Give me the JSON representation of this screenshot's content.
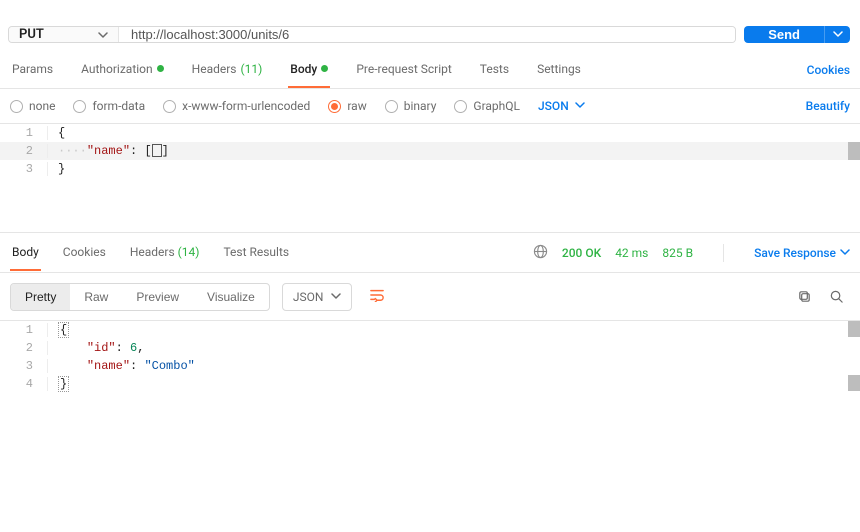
{
  "request": {
    "method": "PUT",
    "url": "http://localhost:3000/units/6",
    "send_label": "Send"
  },
  "request_tabs": {
    "params": "Params",
    "authorization": "Authorization",
    "headers_label": "Headers",
    "headers_count": "(11)",
    "body": "Body",
    "pre_request": "Pre-request Script",
    "tests": "Tests",
    "settings": "Settings",
    "cookies": "Cookies"
  },
  "body_types": {
    "none": "none",
    "form_data": "form-data",
    "urlencoded": "x-www-form-urlencoded",
    "raw": "raw",
    "binary": "binary",
    "graphql": "GraphQL",
    "lang": "JSON",
    "beautify": "Beautify"
  },
  "request_body_lines": {
    "l1": "{",
    "l2_indent": "····",
    "l2_key": "\"name\"",
    "l2_colon": ": ",
    "l2_val_open": "[",
    "l2_val_close": "]",
    "l3": "}"
  },
  "response_tabs": {
    "body": "Body",
    "cookies": "Cookies",
    "headers_label": "Headers",
    "headers_count": "(14)",
    "test_results": "Test Results"
  },
  "response_status": {
    "status": "200 OK",
    "time": "42 ms",
    "size": "825 B",
    "save": "Save Response"
  },
  "response_toolbar": {
    "pretty": "Pretty",
    "raw": "Raw",
    "preview": "Preview",
    "visualize": "Visualize",
    "lang": "JSON"
  },
  "response_body_lines": {
    "l1": "{",
    "l2_key": "\"id\"",
    "l2_val": "6",
    "l3_key": "\"name\"",
    "l3_val": "\"Combo\"",
    "l4": "}"
  }
}
